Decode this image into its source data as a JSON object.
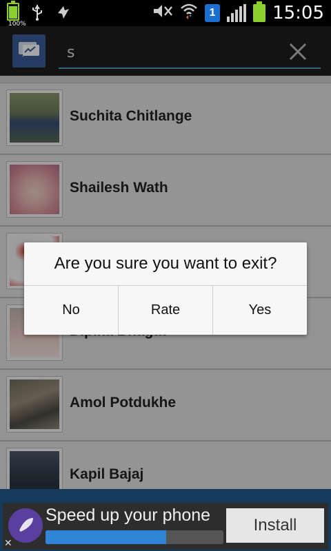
{
  "status_bar": {
    "battery_left_percent": "100%",
    "time": "15:05",
    "sim_badge": "1",
    "icons": [
      "battery-icon",
      "usb-icon",
      "sync-icon",
      "mute-icon",
      "wifi-icon",
      "sim-icon",
      "signal-icon",
      "battery-icon"
    ]
  },
  "search": {
    "value": "s",
    "icons": [
      "messenger-icon",
      "close-icon"
    ]
  },
  "contacts": [
    {
      "name": "Suchita Chitlange"
    },
    {
      "name": "Shailesh Wath"
    },
    {
      "name": ""
    },
    {
      "name": "Dipika Bhagat"
    },
    {
      "name": "Amol Potdukhe"
    },
    {
      "name": "Kapil Bajaj"
    }
  ],
  "dialog": {
    "message": "Are you sure you want to exit?",
    "buttons": {
      "no": "No",
      "rate": "Rate",
      "yes": "Yes"
    }
  },
  "ad": {
    "text": "Speed up your phone",
    "install": "Install",
    "close": "✕",
    "progress": 0.68
  },
  "colors": {
    "accent_underline": "#4aa3c5",
    "app_icon_bg": "#3c5d9c",
    "battery_green": "#8bd02d"
  }
}
